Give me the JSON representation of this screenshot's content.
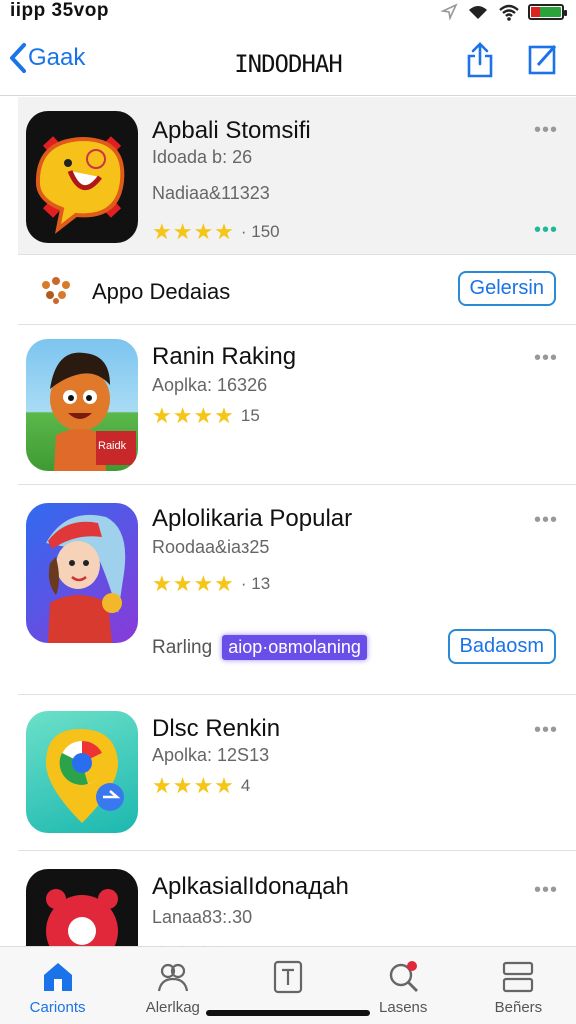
{
  "status": {
    "time": "iipp 35voр"
  },
  "nav": {
    "back_label": "Gaak",
    "title": "INDODHAH"
  },
  "featured": {
    "name": "Apbali Stomsifi",
    "sub1": "Idoada b: 26",
    "sub2": "Nadiaa&11323",
    "rating_text": "· 150",
    "stars": "★★★★"
  },
  "section": {
    "label": "Appo Dedaias",
    "button": "Gelersin"
  },
  "apps": [
    {
      "name": "Ranin Raking",
      "sub": "Aoplka: 16326",
      "stars": "★★★★",
      "rating_text": "15"
    },
    {
      "name": "Aplolikaria Popular",
      "sub": "Roodaa&iaз25",
      "stars": "★★★★",
      "rating_text": "· 13",
      "chip_label": "Rarling",
      "chip": "aiop·oвmolaning",
      "button": "Badaosm"
    },
    {
      "name": "Dlsc Renkin",
      "sub": "Apolka: 12S13",
      "stars": "★★★★",
      "rating_text": "4"
    },
    {
      "name": "AplkasialIdonaдah",
      "sub": "Lanaa83:.30",
      "stars": "★★★★"
    }
  ],
  "more_glyph": "•••",
  "tabs": [
    {
      "label": "Carionts",
      "active": true
    },
    {
      "label": "Alerlkag"
    },
    {
      "label": ""
    },
    {
      "label": "Lasens"
    },
    {
      "label": "Beñers"
    }
  ],
  "colors": {
    "accent": "#1a73e8",
    "star": "#f5c518",
    "chip": "#6a4ee8"
  }
}
